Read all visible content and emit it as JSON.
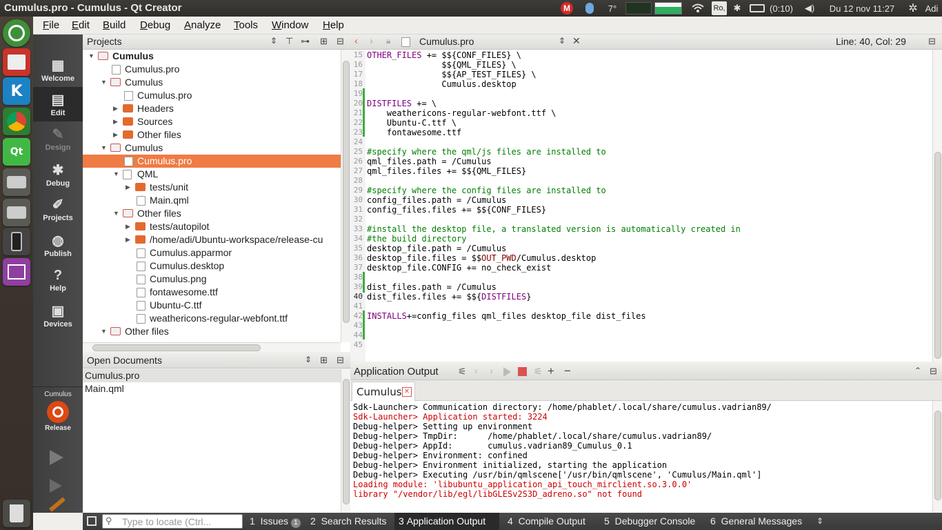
{
  "window": {
    "title": "Cumulus.pro - Cumulus - Qt Creator"
  },
  "topbar": {
    "temperature": "7°",
    "keyboard": "Ro,",
    "battery": "(0:10)",
    "clock": "Du 12 nov 11:27",
    "user": "Adi"
  },
  "menu": [
    {
      "label": "File",
      "u": "F",
      "rest": "ile"
    },
    {
      "label": "Edit",
      "u": "E",
      "rest": "dit"
    },
    {
      "label": "Build",
      "u": "B",
      "rest": "uild"
    },
    {
      "label": "Debug",
      "u": "D",
      "rest": "ebug"
    },
    {
      "label": "Analyze",
      "u": "A",
      "rest": "nalyze"
    },
    {
      "label": "Tools",
      "u": "T",
      "rest": "ools"
    },
    {
      "label": "Window",
      "u": "W",
      "rest": "indow"
    },
    {
      "label": "Help",
      "u": "H",
      "rest": "elp"
    }
  ],
  "modes": [
    "Welcome",
    "Edit",
    "Design",
    "Debug",
    "Projects",
    "Publish",
    "Help",
    "Devices"
  ],
  "kit": {
    "project": "Cumulus",
    "config": "Release"
  },
  "projects_pane": {
    "title": "Projects"
  },
  "tree": [
    {
      "label": "Cumulus",
      "bold": true
    },
    {
      "label": "Cumulus.pro"
    },
    {
      "label": "Cumulus"
    },
    {
      "label": "Cumulus.pro"
    },
    {
      "label": "Headers"
    },
    {
      "label": "Sources"
    },
    {
      "label": "Other files"
    },
    {
      "label": "Cumulus"
    },
    {
      "label": "Cumulus.pro",
      "selected": true
    },
    {
      "label": "QML"
    },
    {
      "label": "tests/unit"
    },
    {
      "label": "Main.qml"
    },
    {
      "label": "Other files"
    },
    {
      "label": "tests/autopilot"
    },
    {
      "label": "/home/adi/Ubuntu-workspace/release-cu"
    },
    {
      "label": "Cumulus.apparmor"
    },
    {
      "label": "Cumulus.desktop"
    },
    {
      "label": "Cumulus.png"
    },
    {
      "label": "fontawesome.ttf"
    },
    {
      "label": "Ubuntu-C.ttf"
    },
    {
      "label": "weathericons-regular-webfont.ttf"
    },
    {
      "label": "Other files"
    }
  ],
  "open_documents": {
    "title": "Open Documents",
    "items": [
      "Cumulus.pro",
      "Main.qml"
    ]
  },
  "editor": {
    "file": "Cumulus.pro",
    "position": "Line: 40, Col: 29",
    "line_numbers": [
      "15",
      "16",
      "17",
      "18",
      "19",
      "20",
      "21",
      "22",
      "23",
      "24",
      "25",
      "26",
      "27",
      "28",
      "29",
      "30",
      "31",
      "32",
      "33",
      "34",
      "35",
      "36",
      "37",
      "38",
      "39",
      "40",
      "41",
      "42",
      "43",
      "44",
      "45"
    ],
    "lines": [
      [
        {
          "t": "OTHER_FILES",
          "c": "kw"
        },
        {
          "t": " += $${CONF_FILES} \\"
        }
      ],
      [
        {
          "t": "               $${QML_FILES} \\"
        }
      ],
      [
        {
          "t": "               $${AP_TEST_FILES} \\"
        }
      ],
      [
        {
          "t": "               Cumulus.desktop"
        }
      ],
      [
        {
          "t": ""
        }
      ],
      [
        {
          "t": "DISTFILES",
          "c": "kw"
        },
        {
          "t": " += \\"
        }
      ],
      [
        {
          "t": "    weathericons-regular-webfont.ttf \\"
        }
      ],
      [
        {
          "t": "    Ubuntu-C.ttf \\"
        }
      ],
      [
        {
          "t": "    fontawesome.ttf"
        }
      ],
      [
        {
          "t": ""
        }
      ],
      [
        {
          "t": "#specify where the qml/js files are installed to",
          "c": "cm"
        }
      ],
      [
        {
          "t": "qml_files.path = /Cumulus"
        }
      ],
      [
        {
          "t": "qml_files.files += $${QML_FILES}"
        }
      ],
      [
        {
          "t": ""
        }
      ],
      [
        {
          "t": "#specify where the config files are installed to",
          "c": "cm"
        }
      ],
      [
        {
          "t": "config_files.path = /Cumulus"
        }
      ],
      [
        {
          "t": "config_files.files += $${CONF_FILES}"
        }
      ],
      [
        {
          "t": ""
        }
      ],
      [
        {
          "t": "#install the desktop file, a translated version is automatically created in",
          "c": "cm"
        }
      ],
      [
        {
          "t": "#the build directory",
          "c": "cm"
        }
      ],
      [
        {
          "t": "desktop_file.path = /Cumulus"
        }
      ],
      [
        {
          "t": "desktop_file.files = $$"
        },
        {
          "t": "OUT_PWD",
          "c": "vr"
        },
        {
          "t": "/Cumulus.desktop"
        }
      ],
      [
        {
          "t": "desktop_file.CONFIG += no_check_exist"
        }
      ],
      [
        {
          "t": ""
        }
      ],
      [
        {
          "t": "dist_files.path = /Cumulus"
        }
      ],
      [
        {
          "t": "dist_files.files += $${"
        },
        {
          "t": "DISTFILES",
          "c": "kw"
        },
        {
          "t": "}"
        }
      ],
      [
        {
          "t": ""
        }
      ],
      [
        {
          "t": "INSTALLS",
          "c": "kw"
        },
        {
          "t": "+=config_files qml_files desktop_file dist_files"
        }
      ],
      [
        {
          "t": ""
        }
      ],
      [
        {
          "t": ""
        }
      ],
      [
        {
          "t": ""
        }
      ]
    ]
  },
  "output_pane": {
    "title": "Application Output",
    "tab": "Cumulus",
    "lines": [
      {
        "t": "Sdk-Launcher> Communication directory: /home/phablet/.local/share/cumulus.vadrian89/",
        "c": "#000000"
      },
      {
        "t": "Sdk-Launcher> Application started: 3224",
        "c": "#cc0000"
      },
      {
        "t": "Debug-helper> Setting up environment",
        "c": "#000000"
      },
      {
        "t": "Debug-helper> TmpDir:      /home/phablet/.local/share/cumulus.vadrian89/",
        "c": "#000000"
      },
      {
        "t": "Debug-helper> AppId:       cumulus.vadrian89_Cumulus_0.1",
        "c": "#000000"
      },
      {
        "t": "Debug-helper> Environment: confined",
        "c": "#000000"
      },
      {
        "t": "Debug-helper> Environment initialized, starting the application",
        "c": "#000000"
      },
      {
        "t": "Debug-helper> Executing /usr/bin/qmlscene['/usr/bin/qmlscene', 'Cumulus/Main.qml']",
        "c": "#000000"
      },
      {
        "t": "Loading module: 'libubuntu_application_api_touch_mirclient.so.3.0.0'",
        "c": "#cc0000"
      },
      {
        "t": "library \"/vendor/lib/egl/libGLESv2S3D_adreno.so\" not found",
        "c": "#cc0000"
      }
    ]
  },
  "statusbar": {
    "locator_placeholder": "Type to locate (Ctrl...",
    "tabs": [
      {
        "num": "1",
        "label": "Issues",
        "badge": "1"
      },
      {
        "num": "2",
        "label": "Search Results"
      },
      {
        "num": "3",
        "label": "Application Output",
        "active": true
      },
      {
        "num": "4",
        "label": "Compile Output"
      },
      {
        "num": "5",
        "label": "Debugger Console"
      },
      {
        "num": "6",
        "label": "General Messages"
      }
    ]
  },
  "colors": {
    "accent": "#ef7b45",
    "launcher": "#3b342c",
    "modebar": "#444444"
  }
}
